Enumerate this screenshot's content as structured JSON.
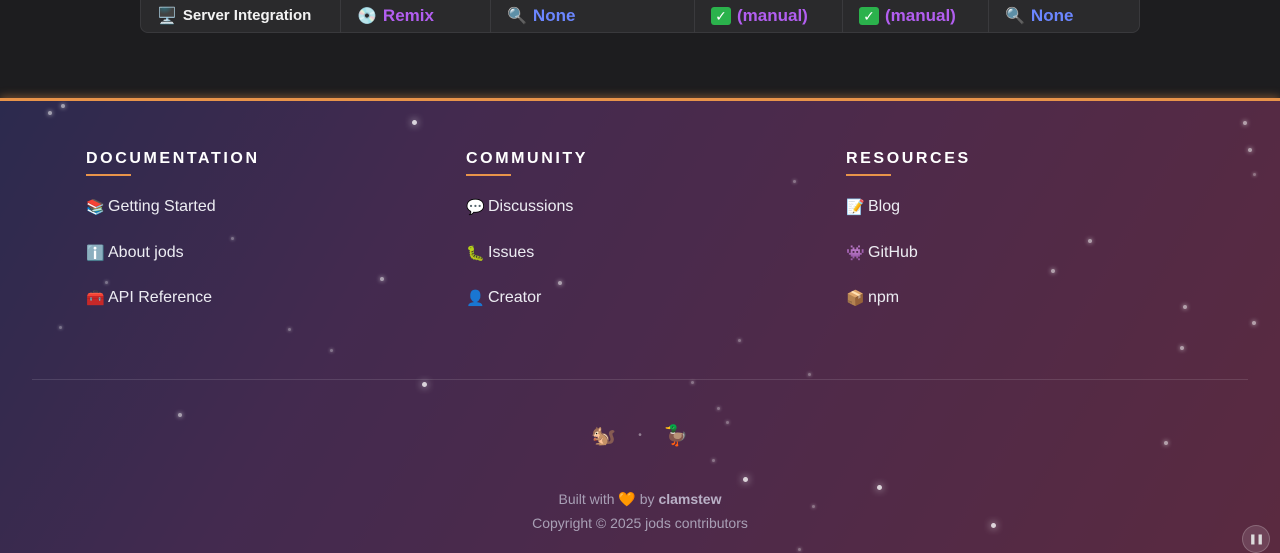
{
  "table_row": {
    "cells": [
      {
        "icon": "🖥️",
        "text": "Server Integration"
      },
      {
        "icon": "💿",
        "text": "Remix"
      },
      {
        "icon": "🔍",
        "text": "None"
      },
      {
        "icon": "✓",
        "text": "(manual)"
      },
      {
        "icon": "✓",
        "text": "(manual)"
      },
      {
        "icon": "🔍",
        "text": "None"
      }
    ]
  },
  "footer": {
    "columns": [
      {
        "title": "DOCUMENTATION",
        "links": [
          {
            "icon": "📚",
            "label": "Getting Started"
          },
          {
            "icon": "ℹ️",
            "label": "About jods"
          },
          {
            "icon": "🧰",
            "label": "API Reference"
          }
        ]
      },
      {
        "title": "COMMUNITY",
        "links": [
          {
            "icon": "💬",
            "label": "Discussions"
          },
          {
            "icon": "🐛",
            "label": "Issues"
          },
          {
            "icon": "👤",
            "label": "Creator"
          }
        ]
      },
      {
        "title": "RESOURCES",
        "links": [
          {
            "icon": "📝",
            "label": "Blog"
          },
          {
            "icon": "👾",
            "label": "GitHub"
          },
          {
            "icon": "📦",
            "label": "npm"
          }
        ]
      }
    ],
    "mascots": {
      "left": "🐿️",
      "separator": "•",
      "right": "🦆"
    },
    "built_prefix": "Built with",
    "heart": "🧡",
    "built_by": "by",
    "author": "clamstew",
    "copyright": "Copyright © 2025 jods contributors",
    "pause_glyph": "❚❚"
  },
  "colors": {
    "accent": "#e8944a",
    "purple_text": "#b25ef0",
    "blue_text": "#6b86ff",
    "check_green": "#2bb24c"
  }
}
